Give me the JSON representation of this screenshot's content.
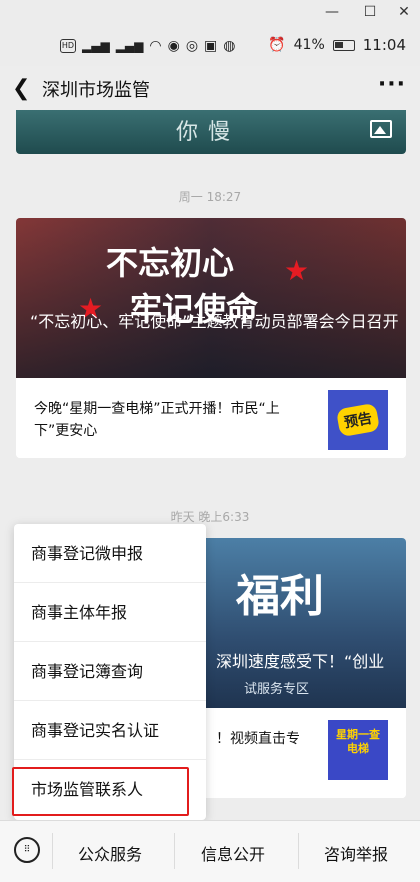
{
  "window": {
    "minimize_icon": "minimize-icon",
    "maximize_icon": "maximize-icon",
    "close_icon": "close-icon"
  },
  "status_bar": {
    "battery_percent": "41%",
    "time": "11:04"
  },
  "nav": {
    "title": "深圳市场监管",
    "more_icon": "more-icon",
    "back_icon": "back-icon"
  },
  "top_banner": {
    "calligraphy": "你慢"
  },
  "messages": [
    {
      "time": "周一 18:27",
      "hero_calligraphy_1": "不忘初心",
      "hero_calligraphy_2": "牢记使命",
      "hero_title": "“不忘初心、牢记使命”主题教育动员部署会今日召开",
      "sub_title": "今晚“星期一查电梯”正式开播！市民“上下”更安心",
      "sub_thumb_text": "预告"
    },
    {
      "time": "昨天 晚上6:33",
      "hero_calligraphy": "福利",
      "hero_title_partial": "深圳速度感受下！“创业",
      "hero_tag": "试服务专区",
      "sub_title_partial": "！视频直击专",
      "sub_thumb_text": "星期一查电梯"
    }
  ],
  "popup_menu": {
    "items": [
      "商事登记微申报",
      "商事主体年报",
      "商事登记簿查询",
      "商事登记实名认证",
      "市场监管联系人"
    ],
    "highlighted_index": 4
  },
  "bottom_bar": {
    "keyboard_icon": "keyboard-icon",
    "tabs": [
      "公众服务",
      "信息公开",
      "咨询举报"
    ]
  }
}
